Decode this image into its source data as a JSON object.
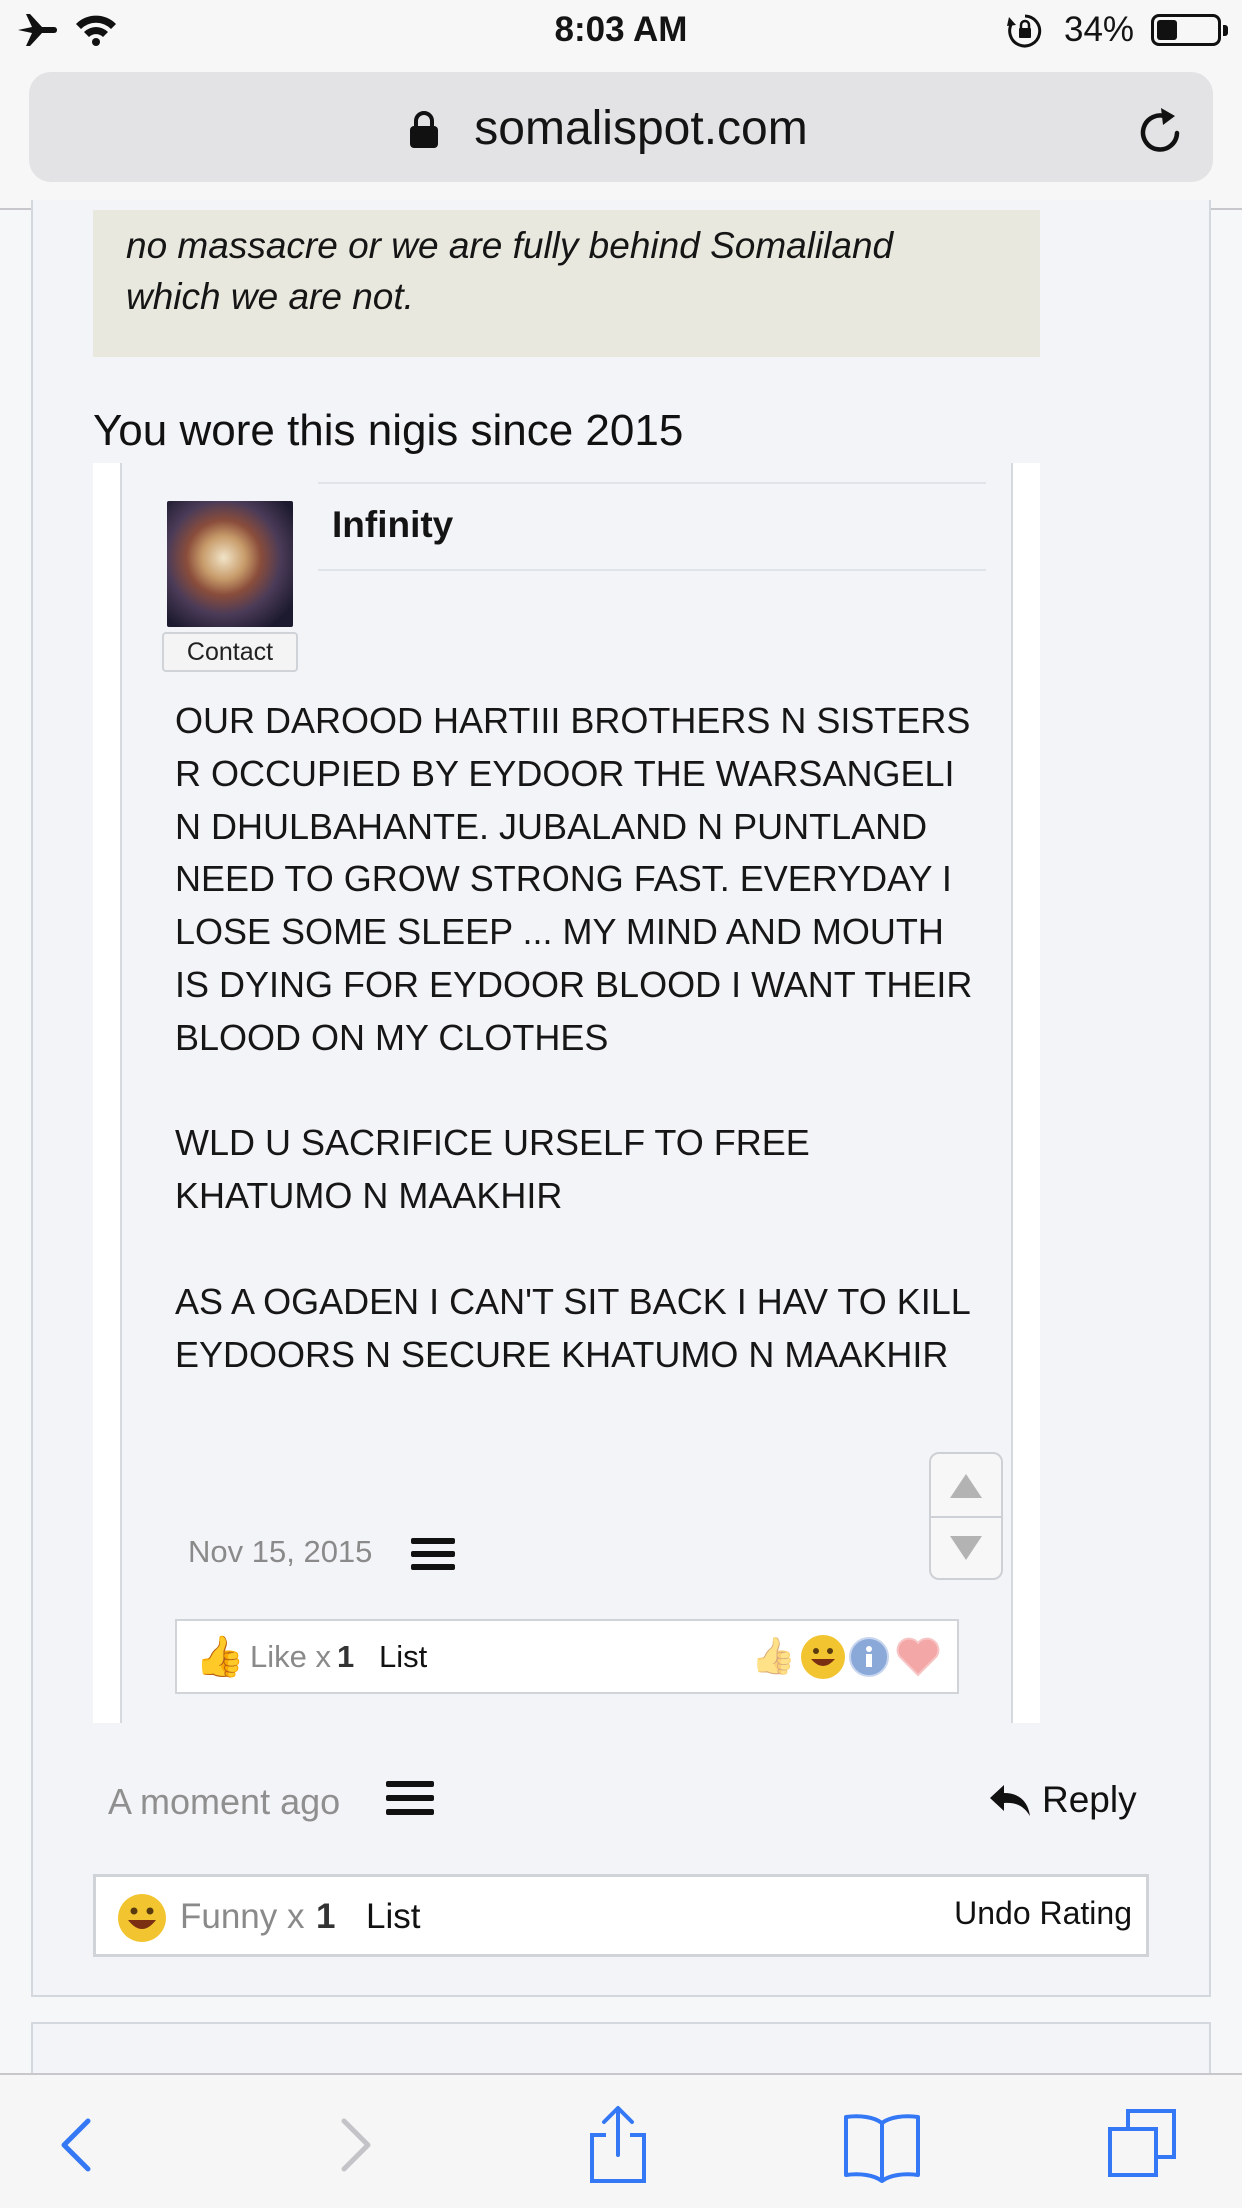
{
  "status_bar": {
    "time": "8:03 AM",
    "battery_percent": "34%"
  },
  "browser": {
    "host": "somalispot.com"
  },
  "post": {
    "quote_text": "no massacre or we are fully behind Somaliland which we are not.",
    "reply_text": "You wore this nigis since 2015",
    "inner_quote": {
      "username": "Infinity",
      "contact_label": "Contact",
      "body": "OUR DAROOD HARTIII BROTHERS N SISTERS R OCCUPIED BY EYDOOR THE WARSANGELI N DHULBAHANTE. JUBALAND N PUNTLAND NEED TO GROW STRONG FAST. EVERYDAY I LOSE SOME SLEEP ... MY MIND AND MOUTH IS DYING FOR EYDOOR BLOOD I WANT THEIR BLOOD ON MY CLOTHES\n\nWLD U SACRIFICE URSELF TO FREE KHATUMO N MAAKHIR\n\nAS A OGADEN I CAN'T SIT BACK I HAV TO KILL EYDOORS N SECURE KHATUMO N MAAKHIR",
      "date": "Nov 15, 2015",
      "rating": {
        "label": "Like x",
        "count": "1",
        "list_label": "List"
      }
    },
    "date": "A moment ago",
    "reply_label": "Reply",
    "rating": {
      "label": "Funny x",
      "count": "1",
      "list_label": "List",
      "undo_label": "Undo Rating"
    }
  },
  "toolbar": {
    "icons": [
      "back-icon",
      "forward-icon",
      "share-icon",
      "bookmarks-icon",
      "tabs-icon"
    ]
  },
  "colors": {
    "link_blue": "#3478f6",
    "quote_bg": "#e8e8de",
    "page_bg": "#f3f4f8"
  }
}
